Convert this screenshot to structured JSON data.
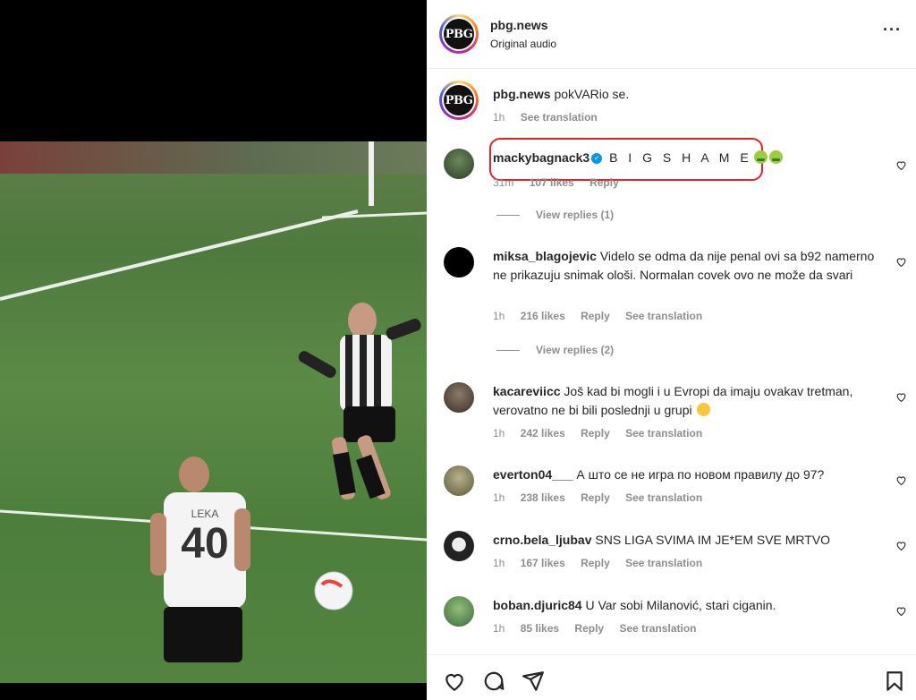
{
  "post": {
    "username": "pbg.news",
    "audio": "Original audio",
    "avatar_text": "PBG",
    "more_icon": "more-horizontal-icon"
  },
  "caption": {
    "username": "pbg.news",
    "text": "pokVARio se.",
    "time": "1h",
    "see_translation": "See translation"
  },
  "comments": [
    {
      "username": "mackybagnack3",
      "verified": true,
      "text": "B I G S H A M E",
      "emoji": [
        "nauseated-face",
        "nauseated-face"
      ],
      "time": "31m",
      "likes": "107 likes",
      "reply": "Reply",
      "view_replies": "View replies (1)"
    },
    {
      "username": "miksa_blagojevic",
      "text": "Videlo se odma da nije penal ovi sa b92 namerno ne prikazuju snimak ološi. Normalan covek ovo ne može da svari",
      "time": "1h",
      "likes": "216 likes",
      "reply": "Reply",
      "see_translation": "See translation",
      "view_replies": "View replies (2)"
    },
    {
      "username": "kacareviicc",
      "text": "Još kad bi mogli i u Evropi da imaju ovakav tretman, verovatno ne bi bili poslednji u grupi",
      "emoji": [
        "downcast-face"
      ],
      "time": "1h",
      "likes": "242 likes",
      "reply": "Reply",
      "see_translation": "See translation"
    },
    {
      "username": "everton04___",
      "text": "А што се не игра по новом правилу до 97?",
      "time": "1h",
      "likes": "238 likes",
      "reply": "Reply",
      "see_translation": "See translation"
    },
    {
      "username": "crno.bela_ljubav",
      "text": "SNS LIGA SVIMA IM JE*EM SVE MRTVO",
      "time": "1h",
      "likes": "167 likes",
      "reply": "Reply",
      "see_translation": "See translation"
    },
    {
      "username": "boban.djuric84",
      "text": "U Var sobi Milanović, stari ciganin.",
      "time": "1h",
      "likes": "85 likes",
      "reply": "Reply",
      "see_translation": "See translation"
    }
  ],
  "video": {
    "player_number": "40",
    "player_name": "LEKA"
  },
  "action_icons": [
    "heart-icon",
    "comment-icon",
    "share-icon",
    "bookmark-icon"
  ],
  "colors": {
    "highlight": "#e0232e",
    "verified": "#0095f6",
    "muted": "#8e8e8e",
    "text": "#262626"
  }
}
